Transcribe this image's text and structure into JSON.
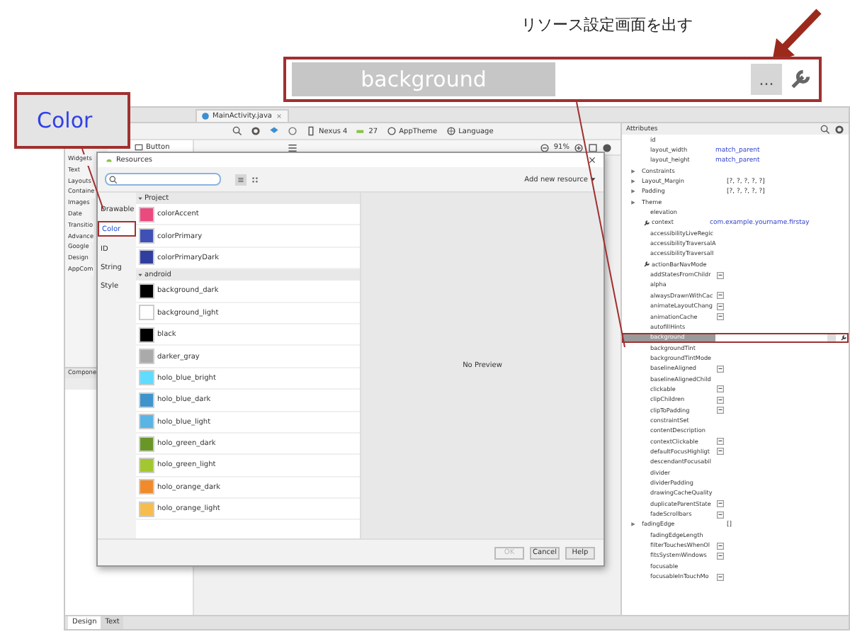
{
  "annotation": {
    "text": "リソース設定画面を出す"
  },
  "zoomed_field": {
    "label": "background",
    "button": "..."
  },
  "color_callout": {
    "text": "Color"
  },
  "editor_tabs": [
    {
      "label": "MainActivity.java",
      "selected": true
    }
  ],
  "toolbar": {
    "device": "Nexus 4",
    "api": "27",
    "theme": "AppTheme",
    "language": "Language"
  },
  "canvas_toolbar": {
    "zoom": "91%"
  },
  "palette": {
    "categories": [
      "Widgets",
      "Text",
      "Layouts",
      "Containe",
      "Images",
      "Date",
      "Transitio",
      "Advance",
      "Google",
      "Design",
      "AppCom"
    ],
    "items": [
      "Button"
    ]
  },
  "component_tree": {
    "title": "Compone"
  },
  "attributes": {
    "title": "Attributes",
    "rows": [
      {
        "name": "id",
        "kind": "plain"
      },
      {
        "name": "layout_width",
        "value": "match_parent",
        "kind": "plain"
      },
      {
        "name": "layout_height",
        "value": "match_parent",
        "kind": "plain"
      },
      {
        "name": "Constraints",
        "kind": "group"
      },
      {
        "name": "Layout_Margin",
        "value": "[?, ?, ?, ?, ?]",
        "kind": "group"
      },
      {
        "name": "Padding",
        "value": "[?, ?, ?, ?, ?]",
        "kind": "group"
      },
      {
        "name": "Theme",
        "kind": "group"
      },
      {
        "name": "elevation",
        "kind": "plain"
      },
      {
        "name": "context",
        "value": "com.example.yourname.firstay",
        "kind": "wrench"
      },
      {
        "name": "accessibilityLiveRegic",
        "kind": "plain"
      },
      {
        "name": "accessibilityTraversalA",
        "kind": "plain"
      },
      {
        "name": "accessibilityTraversalI",
        "kind": "plain"
      },
      {
        "name": "actionBarNavMode",
        "kind": "wrench"
      },
      {
        "name": "addStatesFromChildr",
        "kind": "dropdown"
      },
      {
        "name": "alpha",
        "kind": "plain"
      },
      {
        "name": "alwaysDrawnWithCac",
        "kind": "dropdown"
      },
      {
        "name": "animateLayoutChang",
        "kind": "dropdown"
      },
      {
        "name": "animationCache",
        "kind": "dropdown"
      },
      {
        "name": "autofillHints",
        "kind": "plain"
      },
      {
        "name": "background",
        "kind": "field"
      },
      {
        "name": "backgroundTint",
        "kind": "plain"
      },
      {
        "name": "backgroundTintMode",
        "kind": "plain"
      },
      {
        "name": "baselineAligned",
        "kind": "dropdown"
      },
      {
        "name": "baselineAlignedChild",
        "kind": "plain"
      },
      {
        "name": "clickable",
        "kind": "dropdown"
      },
      {
        "name": "clipChildren",
        "kind": "dropdown"
      },
      {
        "name": "clipToPadding",
        "kind": "dropdown"
      },
      {
        "name": "constraintSet",
        "kind": "plain"
      },
      {
        "name": "contentDescription",
        "kind": "plain"
      },
      {
        "name": "contextClickable",
        "kind": "dropdown"
      },
      {
        "name": "defaultFocusHighligt",
        "kind": "dropdown"
      },
      {
        "name": "descendantFocusabil",
        "kind": "plain"
      },
      {
        "name": "divider",
        "kind": "plain"
      },
      {
        "name": "dividerPadding",
        "kind": "plain"
      },
      {
        "name": "drawingCacheQuality",
        "kind": "plain"
      },
      {
        "name": "duplicateParentState",
        "kind": "dropdown"
      },
      {
        "name": "fadeScrollbars",
        "kind": "dropdown"
      },
      {
        "name": "fadingEdge",
        "value": "[]",
        "kind": "group"
      },
      {
        "name": "fadingEdgeLength",
        "kind": "plain"
      },
      {
        "name": "filterTouchesWhenOl",
        "kind": "dropdown"
      },
      {
        "name": "fitsSystemWindows",
        "kind": "dropdown"
      },
      {
        "name": "focusable",
        "kind": "plain"
      },
      {
        "name": "focusableInTouchMo",
        "kind": "dropdown"
      }
    ]
  },
  "dialog": {
    "title": "Resources",
    "add_button": "Add new resource",
    "categories": [
      {
        "label": "Drawable",
        "selected": false
      },
      {
        "label": "Color",
        "selected": true
      },
      {
        "label": "ID",
        "selected": false
      },
      {
        "label": "String",
        "selected": false
      },
      {
        "label": "Style",
        "selected": false
      }
    ],
    "sections": [
      {
        "title": "Project",
        "items": [
          {
            "name": "colorAccent",
            "color": "#ea4a7d"
          },
          {
            "name": "colorPrimary",
            "color": "#3f51b5"
          },
          {
            "name": "colorPrimaryDark",
            "color": "#303f9f"
          }
        ]
      },
      {
        "title": "android",
        "items": [
          {
            "name": "background_dark",
            "color": "#000000"
          },
          {
            "name": "background_light",
            "color": "#ffffff"
          },
          {
            "name": "black",
            "color": "#000000"
          },
          {
            "name": "darker_gray",
            "color": "#aaaaaa"
          },
          {
            "name": "holo_blue_bright",
            "color": "#5fdcff"
          },
          {
            "name": "holo_blue_dark",
            "color": "#3d95cc"
          },
          {
            "name": "holo_blue_light",
            "color": "#5ab4e4"
          },
          {
            "name": "holo_green_dark",
            "color": "#6a9628"
          },
          {
            "name": "holo_green_light",
            "color": "#a2c72f"
          },
          {
            "name": "holo_orange_dark",
            "color": "#f08a2a"
          },
          {
            "name": "holo_orange_light",
            "color": "#f6bd4e"
          }
        ]
      }
    ],
    "preview": "No Preview",
    "buttons": [
      {
        "label": "OK",
        "disabled": true
      },
      {
        "label": "Cancel",
        "disabled": false
      },
      {
        "label": "Help",
        "disabled": false
      }
    ]
  },
  "bottom_tabs": [
    {
      "label": "Design",
      "selected": true
    },
    {
      "label": "Text",
      "selected": false
    }
  ]
}
